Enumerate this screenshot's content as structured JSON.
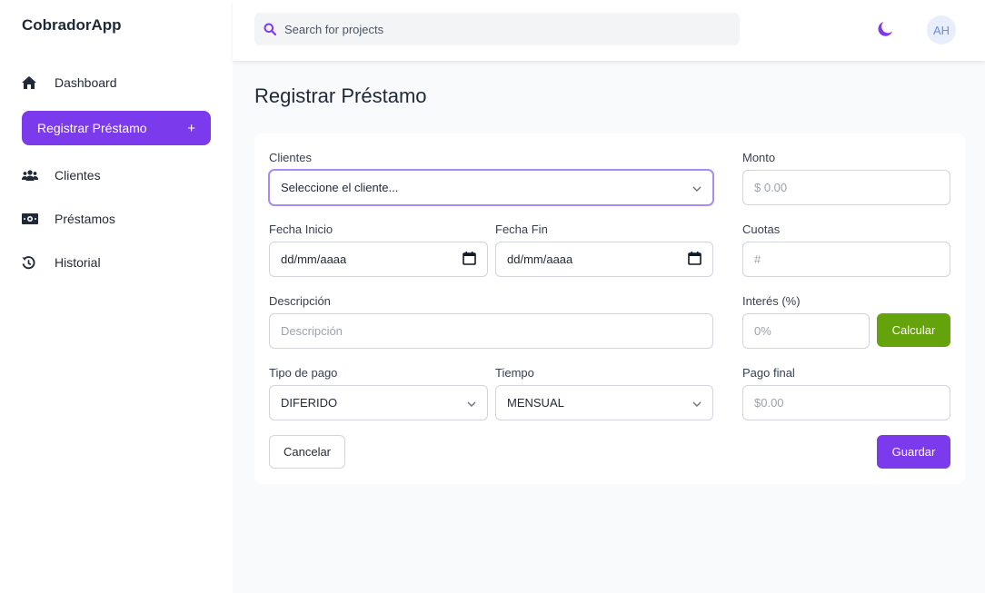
{
  "app": {
    "brand": "CobradorApp"
  },
  "sidebar": {
    "items": [
      {
        "label": "Dashboard",
        "icon": "home-icon"
      },
      {
        "label": "Registrar Préstamo",
        "icon": "plus-icon",
        "active": true,
        "suffix": "+"
      },
      {
        "label": "Clientes",
        "icon": "users-icon"
      },
      {
        "label": "Préstamos",
        "icon": "money-bill-icon"
      },
      {
        "label": "Historial",
        "icon": "history-icon"
      }
    ]
  },
  "header": {
    "search_placeholder": "Search for projects",
    "theme_icon": "moon-icon",
    "avatar_initials": "AH"
  },
  "page": {
    "title": "Registrar Préstamo"
  },
  "form": {
    "clientes": {
      "label": "Clientes",
      "value": "Seleccione el cliente..."
    },
    "monto": {
      "label": "Monto",
      "placeholder": "$ 0.00"
    },
    "fecha_inicio": {
      "label": "Fecha Inicio",
      "value": "dd/mm/aaaa"
    },
    "fecha_fin": {
      "label": "Fecha Fin",
      "value": "dd/mm/aaaa"
    },
    "cuotas": {
      "label": "Cuotas",
      "placeholder": "#"
    },
    "descripcion": {
      "label": "Descripción",
      "placeholder": "Descripción"
    },
    "interes": {
      "label": "Interés (%)",
      "placeholder": "0%"
    },
    "calcular_label": "Calcular",
    "tipo_pago": {
      "label": "Tipo de pago",
      "value": "DIFERIDO"
    },
    "tiempo": {
      "label": "Tiempo",
      "value": "MENSUAL"
    },
    "pago_final": {
      "label": "Pago final",
      "placeholder": "$0.00"
    },
    "cancelar_label": "Cancelar",
    "guardar_label": "Guardar"
  },
  "colors": {
    "accent": "#7c3aed",
    "success": "#65a30d",
    "avatar_bg": "#e8eefb"
  }
}
